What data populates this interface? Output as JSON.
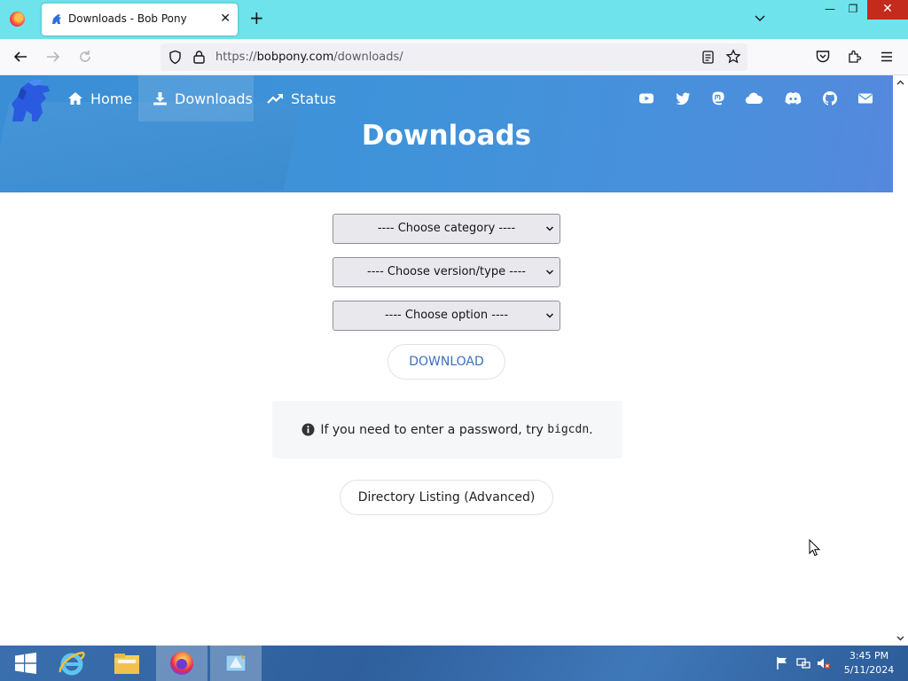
{
  "browser": {
    "tab_title": "Downloads - Bob Pony",
    "tab_close": "✕",
    "new_tab": "+",
    "url_scheme": "https://",
    "url_host": "bobpony.com",
    "url_path": "/downloads/",
    "window_controls": {
      "minimize": "—",
      "maximize": "❐",
      "close": "✕"
    }
  },
  "site": {
    "nav": [
      {
        "label": "Home",
        "icon": "home-icon"
      },
      {
        "label": "Downloads",
        "icon": "download-icon",
        "active": true
      },
      {
        "label": "Status",
        "icon": "trending-up-icon"
      }
    ],
    "social_icons": [
      "youtube-icon",
      "twitter-icon",
      "mastodon-icon",
      "cloud-icon",
      "discord-icon",
      "github-icon",
      "email-icon"
    ],
    "page_title": "Downloads",
    "accent_color": "#3f93d9"
  },
  "form": {
    "category_select": "---- Choose category ----",
    "version_select": "---- Choose version/type ----",
    "option_select": "---- Choose option ----",
    "download_button": "DOWNLOAD"
  },
  "notice": {
    "text": "If you need to enter a password, try ",
    "password": "bigcdn",
    "suffix": "."
  },
  "directory_button": "Directory Listing (Advanced)",
  "taskbar": {
    "time": "3:45 PM",
    "date": "5/11/2024"
  }
}
